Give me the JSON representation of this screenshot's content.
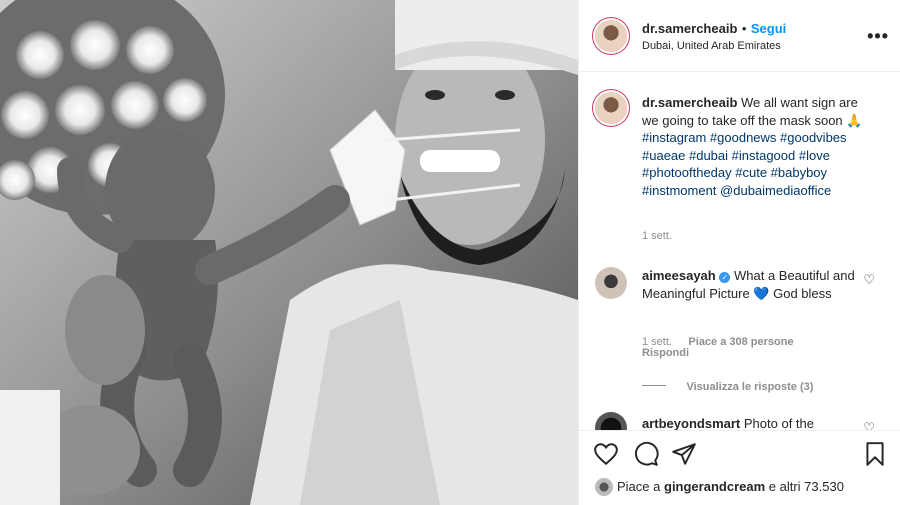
{
  "post": {
    "author": "dr.samercheaib",
    "separator": "•",
    "follow_label": "Segui",
    "location": "Dubai, United Arab Emirates",
    "more_label": "•••"
  },
  "caption": {
    "author": "dr.samercheaib",
    "text": "We all want sign are we going to take off the mask soon 🙏",
    "hashtags": "#instagram #goodnews #goodvibes #uaeae #dubai #instagood #love #photooftheday #cute #babyboy #instmoment @dubaimediaoffice",
    "time": "1 sett."
  },
  "comments": [
    {
      "author": "aimeesayah",
      "verified": true,
      "text": "What a Beautiful and Meaningful Picture",
      "emoji": "💙",
      "text_end": "God bless",
      "time": "1 sett.",
      "likes": "Piace a 308 persone",
      "reply_label": "Rispondi",
      "view_replies": "Visualizza le risposte (3)"
    },
    {
      "author": "artbeyondsmart",
      "text": "Photo of the"
    }
  ],
  "actions": {
    "like_icon": "heart-icon",
    "comment_icon": "comment-icon",
    "share_icon": "paper-plane-icon",
    "save_icon": "bookmark-icon"
  },
  "likes": {
    "prefix": "Piace a",
    "user": "gingerandcream",
    "suffix": "e altri 73.530"
  },
  "colors": {
    "link": "#0095f6",
    "hashtag": "#00376b",
    "muted": "#8e8e8e",
    "text": "#262626"
  }
}
